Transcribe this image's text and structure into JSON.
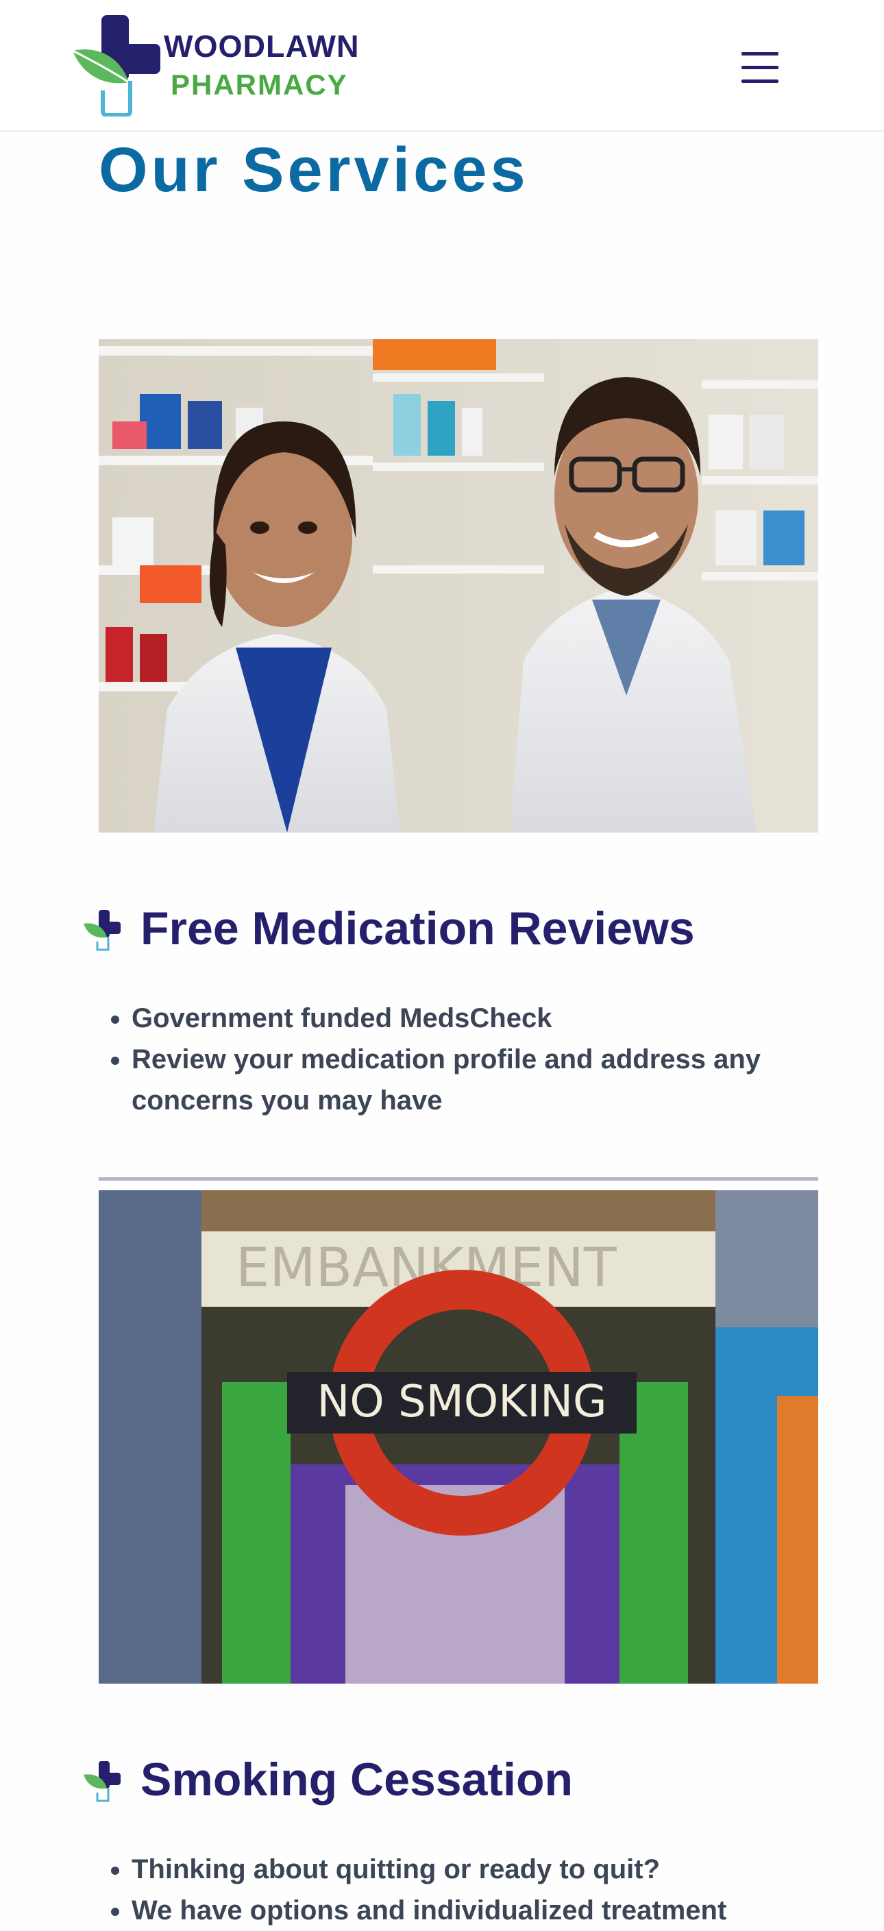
{
  "header": {
    "brand_line1": "WOODLAWN",
    "brand_line2": "PHARMACY",
    "logo_icon": "cross-leaf-logo-icon",
    "menu_icon": "hamburger-menu-icon"
  },
  "page": {
    "title": "Our Services"
  },
  "sections": [
    {
      "title": "Free Medication Reviews",
      "icon": "cross-leaf-bullet-icon",
      "bullets": [
        "Government funded MedsCheck",
        "Review your medication profile and address any concerns you may have"
      ]
    },
    {
      "title": "Smoking Cessation",
      "icon": "cross-leaf-bullet-icon",
      "bullets": [
        "Thinking about quitting or ready to quit?",
        "We have options and individualized treatment"
      ]
    }
  ],
  "photos": {
    "pharmacists": "two smiling pharmacists in white lab coats in front of medicine shelves",
    "no_smoking_sign_text": "NO SMOKING",
    "no_smoking_sign_bg_text": "EMBANKMENT"
  },
  "colors": {
    "navy": "#25206b",
    "green": "#49a942",
    "title_blue": "#0a6aa1",
    "body_text": "#3b4555",
    "sign_red": "#d0361f"
  }
}
